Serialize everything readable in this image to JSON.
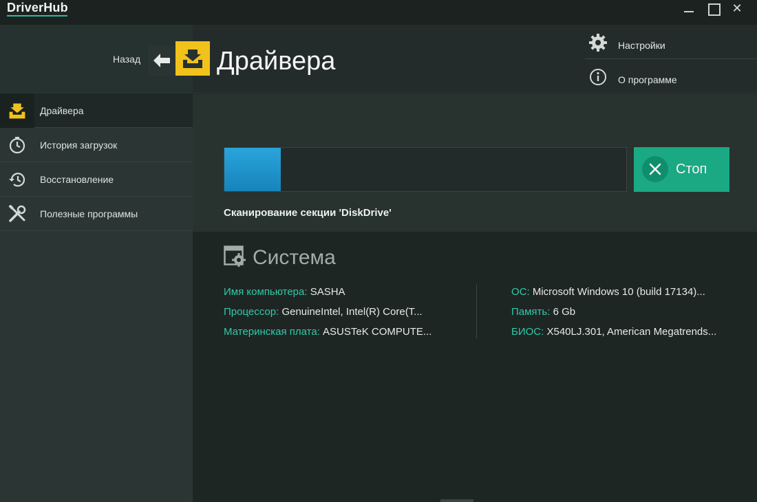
{
  "app": {
    "logo": "DriverHub",
    "close_glyph": "✕"
  },
  "header": {
    "back_label": "Назад",
    "title": "Драйвера",
    "menu": [
      {
        "label": "Настройки",
        "icon": "gear-icon"
      },
      {
        "label": "О программе",
        "icon": "info-icon"
      }
    ]
  },
  "sidebar": {
    "items": [
      {
        "label": "Драйвера",
        "icon": "driver-tray-icon",
        "active": true
      },
      {
        "label": "История загрузок",
        "icon": "clock-icon",
        "active": false
      },
      {
        "label": "Восстановление",
        "icon": "restore-history-icon",
        "active": false
      },
      {
        "label": "Полезные программы",
        "icon": "tools-icon",
        "active": false
      }
    ]
  },
  "scan": {
    "progress_percent": 14,
    "stop_label": "Стоп",
    "status": "Сканирование секции 'DiskDrive'"
  },
  "system": {
    "title": "Система",
    "left": [
      {
        "key": "Имя компьютера:",
        "value": "SASHA"
      },
      {
        "key": "Процессор:",
        "value": "GenuineIntel, Intel(R) Core(T..."
      },
      {
        "key": "Материнская плата:",
        "value": "ASUSTeK COMPUTE..."
      }
    ],
    "right": [
      {
        "key": "ОС:",
        "value": "Microsoft Windows 10  (build 17134)..."
      },
      {
        "key": "Память:",
        "value": "6 Gb"
      },
      {
        "key": "БИОС:",
        "value": "X540LJ.301, American Megatrends..."
      }
    ]
  },
  "colors": {
    "accent_yellow": "#f1c21b",
    "accent_green": "#1aa983",
    "progress_blue": "#2aa4dc",
    "info_key": "#33c9a8"
  }
}
